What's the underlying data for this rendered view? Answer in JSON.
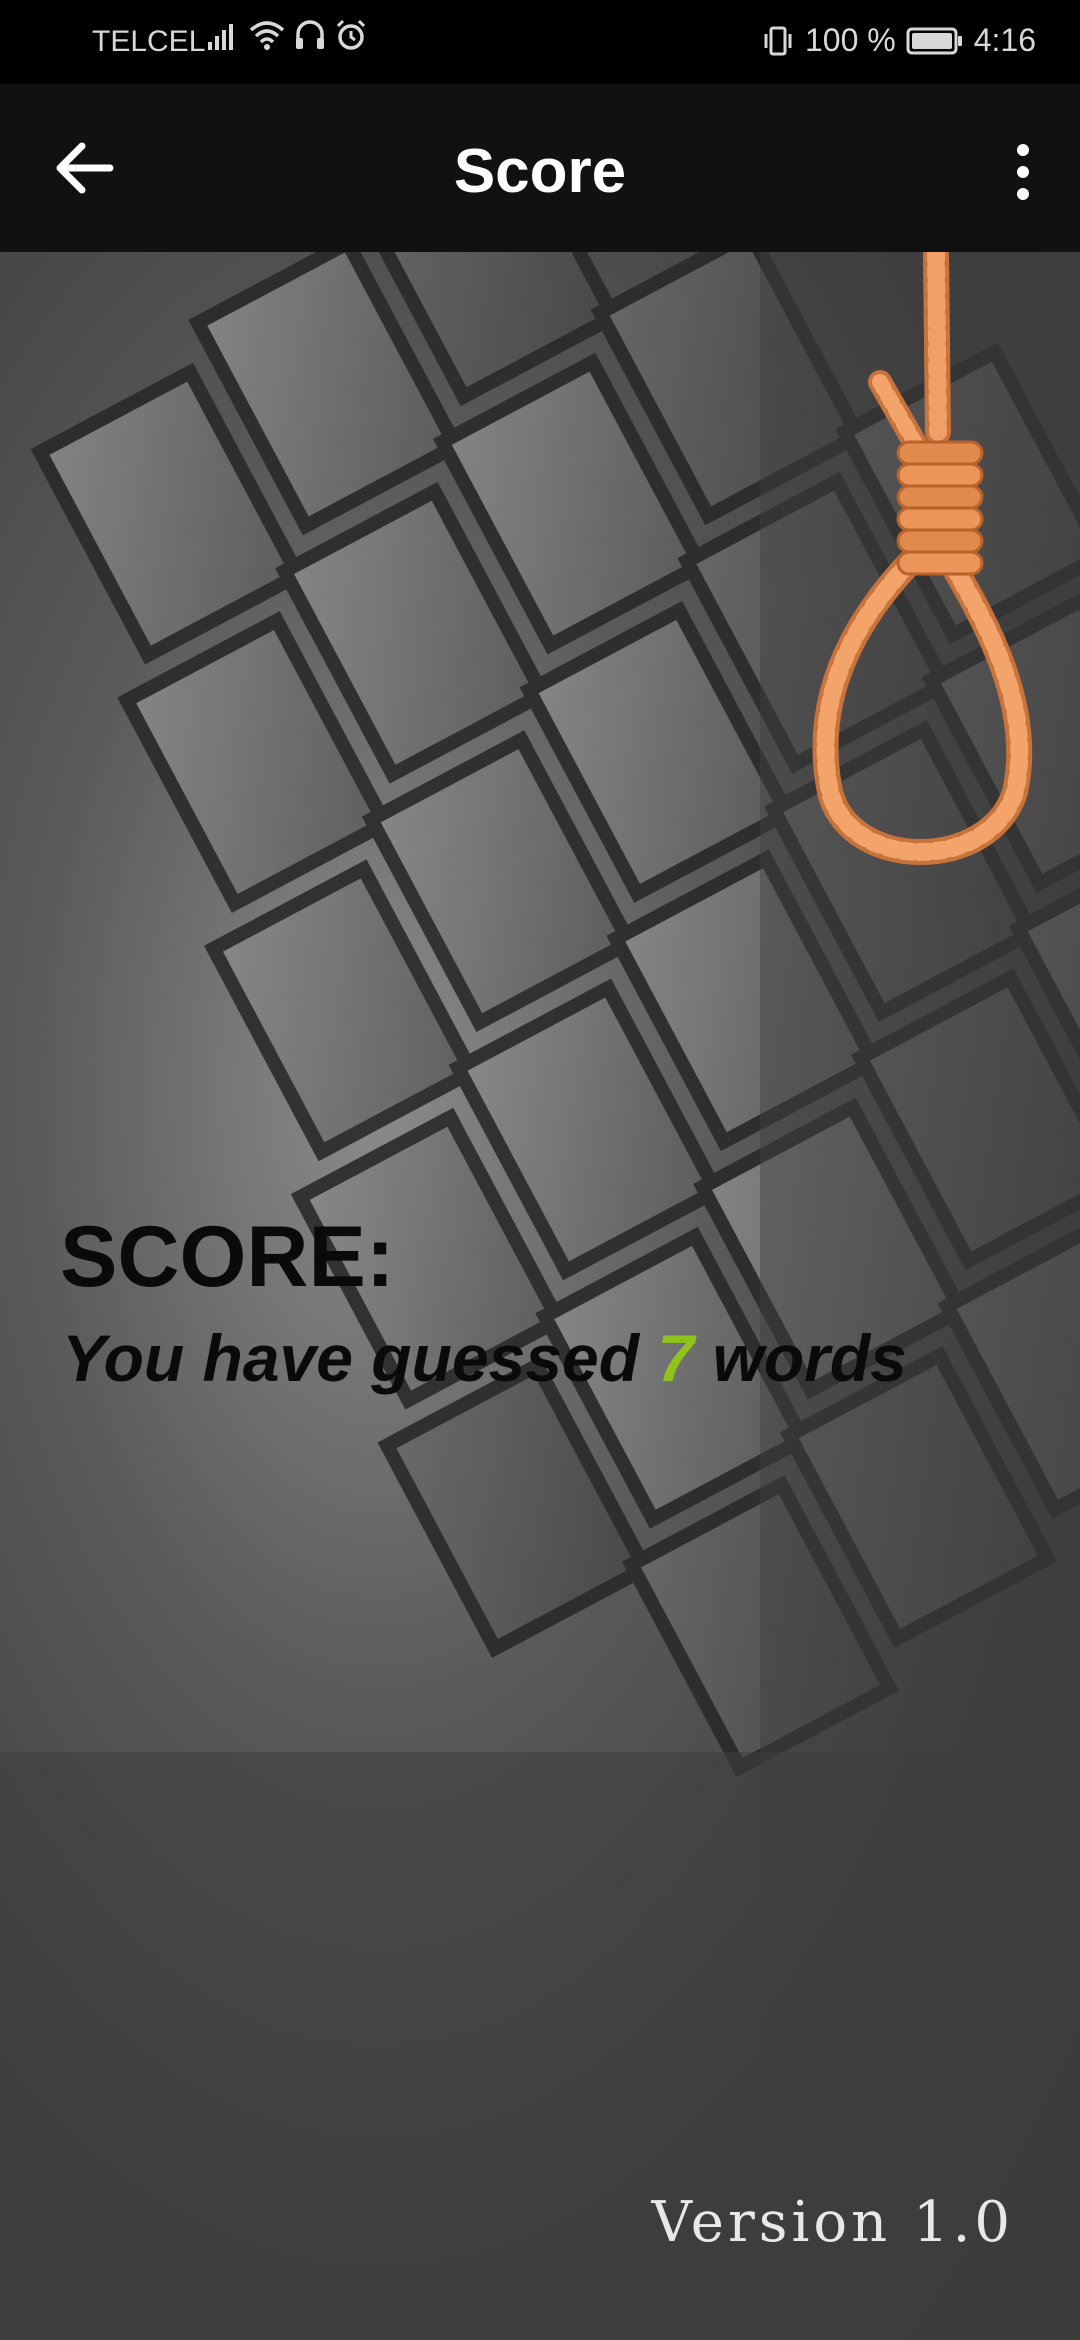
{
  "status_bar": {
    "carrier": "TELCEL",
    "battery": "100 %",
    "time": "4:16",
    "icons": [
      "signal-icon",
      "wifi-icon",
      "headphones-icon",
      "alarm-icon",
      "vibrate-icon",
      "battery-icon"
    ]
  },
  "app_bar": {
    "title": "Score",
    "back_icon": "arrow-left-icon",
    "menu_icon": "more-vert-icon"
  },
  "score": {
    "heading": "SCORE:",
    "prefix": "You have guessed ",
    "count": "7",
    "suffix": " words"
  },
  "footer": {
    "version": "Version 1.0"
  },
  "colors": {
    "app_bar": "#111111",
    "count_accent": "#8fc21c",
    "rope": "#e9955a"
  }
}
